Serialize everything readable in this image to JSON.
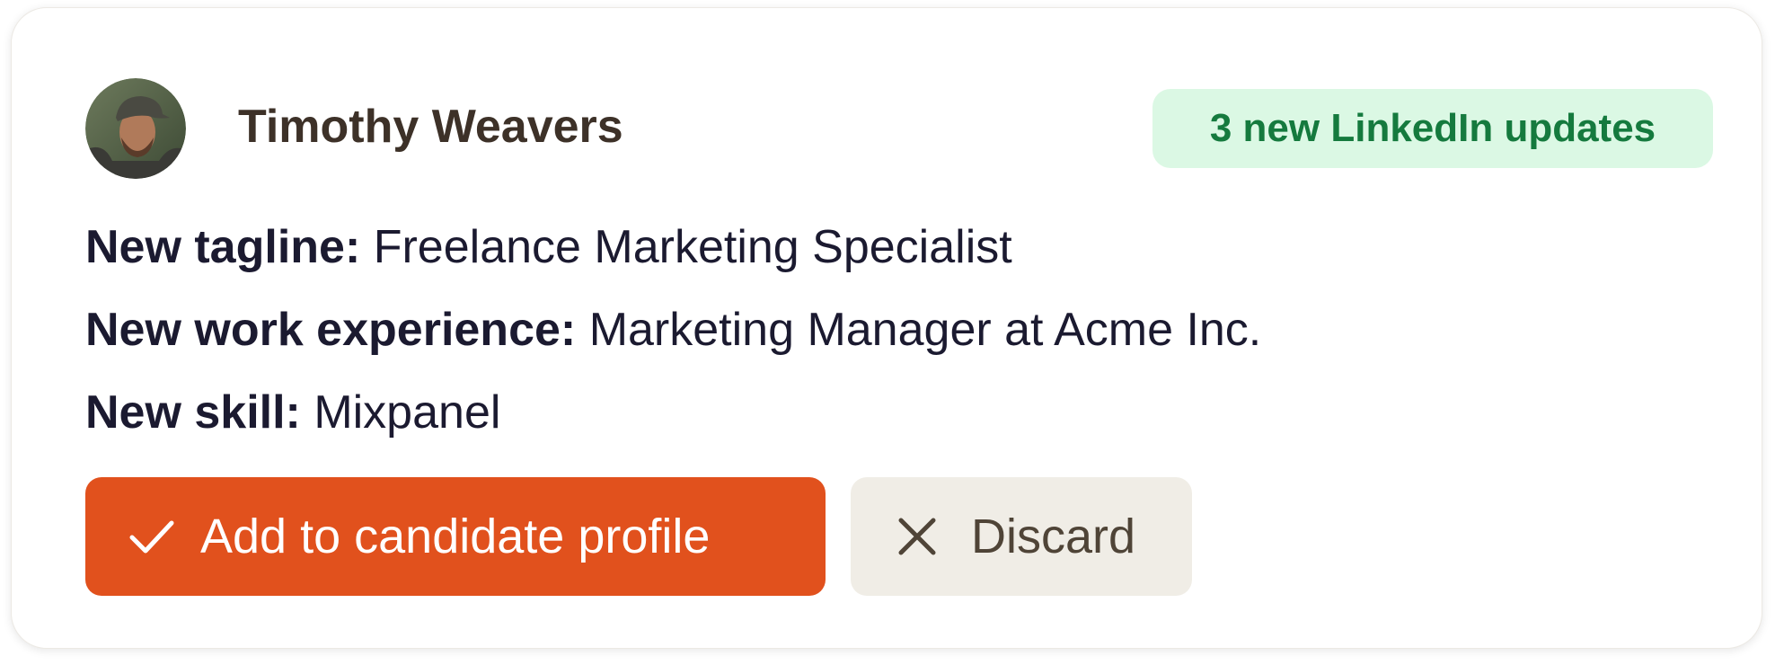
{
  "candidate": {
    "name": "Timothy Weavers"
  },
  "badge": {
    "label": "3 new LinkedIn updates"
  },
  "updates": [
    {
      "key": "New tagline:",
      "value": "Freelance Marketing Specialist"
    },
    {
      "key": "New work experience:",
      "value": "Marketing Manager at Acme Inc."
    },
    {
      "key": "New skill:",
      "value": "Mixpanel"
    }
  ],
  "actions": {
    "add_label": "Add to candidate profile",
    "add_icon": "checkmark-icon",
    "discard_label": "Discard",
    "discard_icon": "close-icon"
  },
  "colors": {
    "primary": "#e1511d",
    "badge_bg": "#dbf8e4",
    "badge_text": "#157a3e",
    "secondary_bg": "#f0ede6"
  }
}
